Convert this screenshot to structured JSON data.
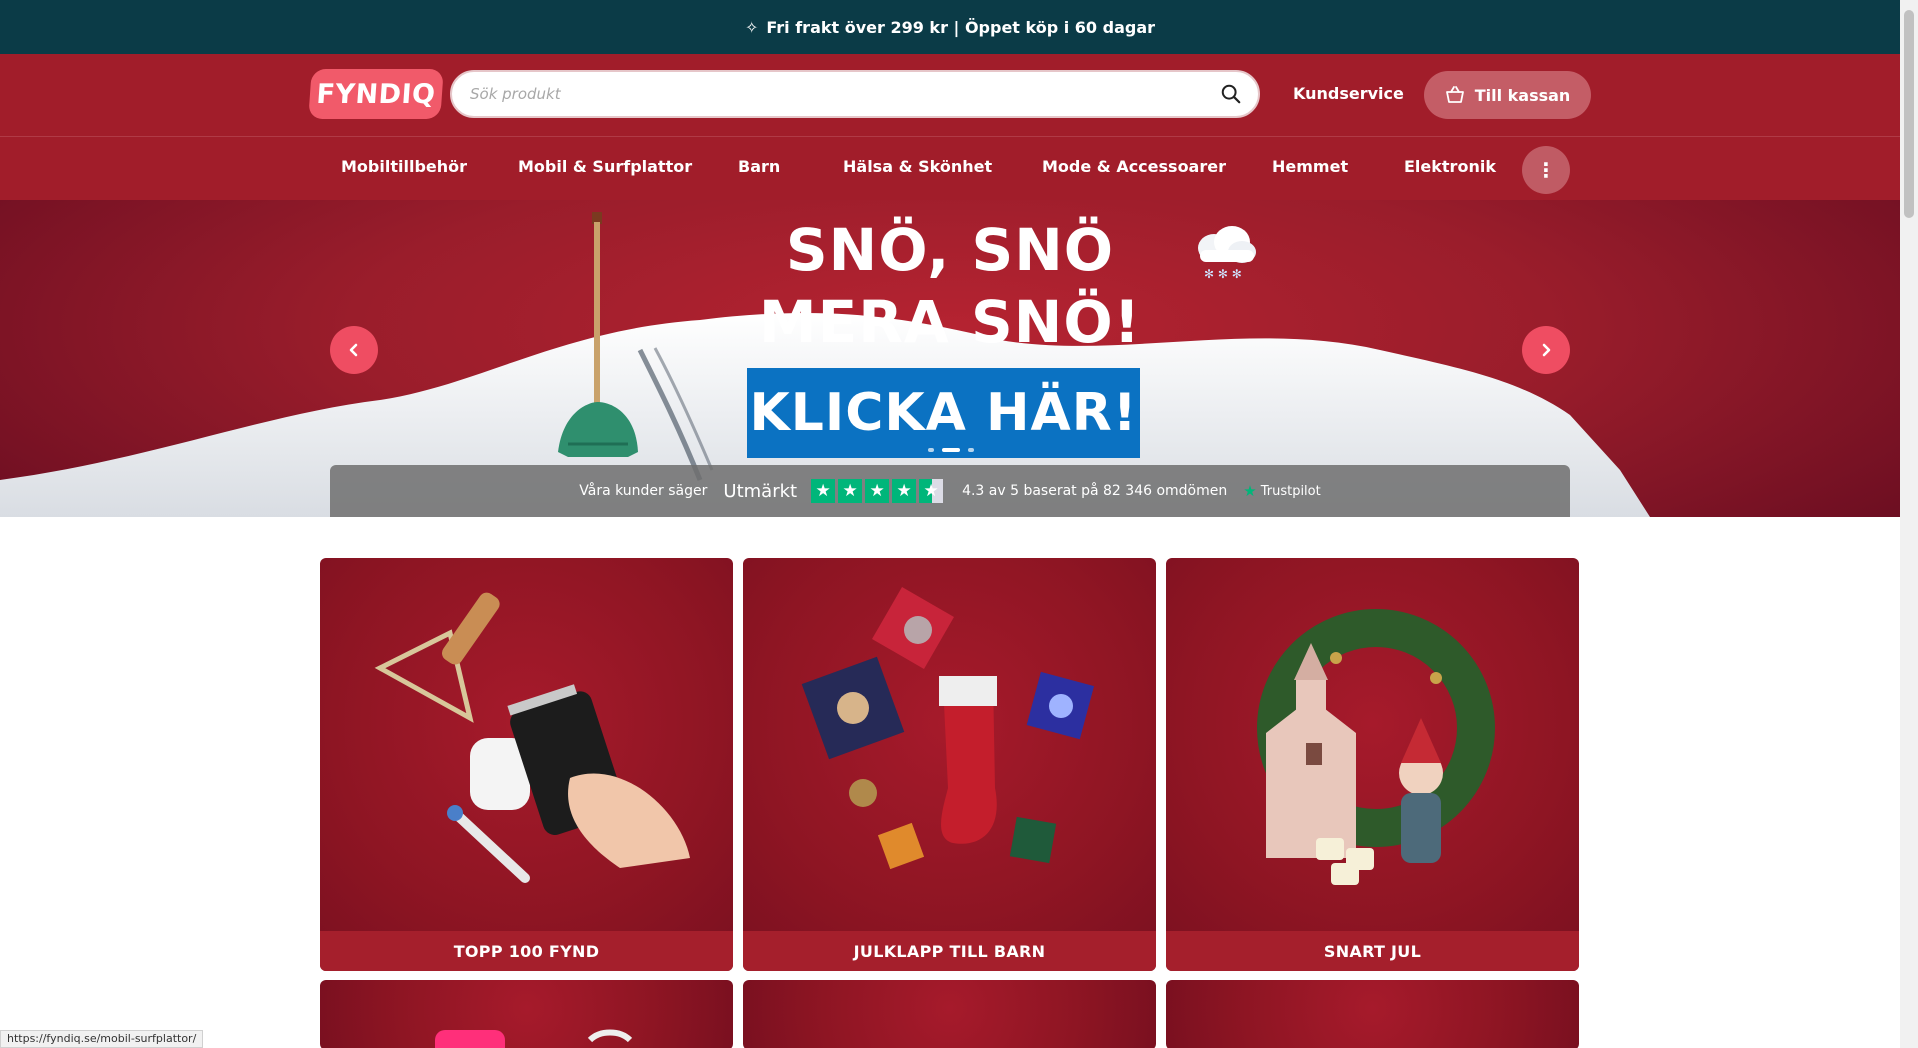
{
  "announcement": {
    "text": "Fri frakt över 299 kr | Öppet köp i 60 dagar"
  },
  "header": {
    "logo_text": "FYNDIQ",
    "search_placeholder": "Sök produkt",
    "customer_service": "Kundservice",
    "checkout": "Till kassan"
  },
  "nav": {
    "items": [
      {
        "label": "Mobiltillbehör"
      },
      {
        "label": "Mobil & Surfplattor"
      },
      {
        "label": "Barn"
      },
      {
        "label": "Hälsa & Skönhet"
      },
      {
        "label": "Mode & Accessoarer"
      },
      {
        "label": "Hemmet"
      },
      {
        "label": "Elektronik"
      }
    ],
    "more_icon": "vertical-dots-icon"
  },
  "hero": {
    "title_line1": "SNÖ, SNÖ",
    "title_line2": "MERA SNÖ!",
    "cta": "KLICKA HÄR!",
    "slide_index": 2,
    "slide_count": 3
  },
  "trustpilot": {
    "says": "Våra kunder säger",
    "rating_word": "Utmärkt",
    "summary": "4.3 av 5 baserat på 82 346 omdömen",
    "brand": "Trustpilot",
    "stars": 4.5
  },
  "categories": [
    {
      "label": "TOPP 100 FYND"
    },
    {
      "label": "JULKLAPP TILL BARN"
    },
    {
      "label": "SNART JUL"
    }
  ],
  "status_url": "https://fyndiq.se/mobil-surfplattor/",
  "colors": {
    "topbar": "#0b3b47",
    "header": "#a11d2a",
    "logo": "#f15a6a",
    "accent_button": "#ef4d62",
    "cta_blue": "#0b72c2",
    "trust_green": "#00b67a"
  }
}
